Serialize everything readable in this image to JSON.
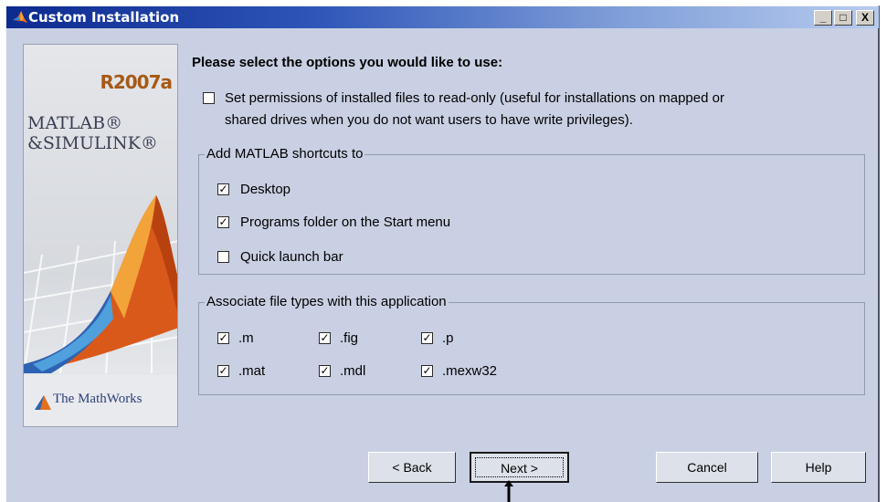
{
  "window": {
    "title": "Custom Installation",
    "controls": {
      "minimize": "_",
      "maximize": "□",
      "close": "X"
    }
  },
  "banner": {
    "release": "R2007a",
    "product": "MATLAB®\n&SIMULINK®",
    "company": "The MathWorks"
  },
  "heading": "Please select the options you would like to use:",
  "permissions": {
    "checked": false,
    "line1": "Set permissions of installed files to read-only (useful for installations on mapped or",
    "line2": "shared drives when you do not want users to have write privileges)."
  },
  "shortcuts": {
    "title": "Add MATLAB shortcuts to",
    "items": [
      {
        "label": "Desktop",
        "checked": true
      },
      {
        "label": "Programs folder on the Start menu",
        "checked": true
      },
      {
        "label": "Quick launch bar",
        "checked": false
      }
    ]
  },
  "associations": {
    "title": "Associate file types with this application",
    "items": [
      {
        "label": ".m",
        "checked": true
      },
      {
        "label": ".fig",
        "checked": true
      },
      {
        "label": ".p",
        "checked": true
      },
      {
        "label": ".mat",
        "checked": true
      },
      {
        "label": ".mdl",
        "checked": true
      },
      {
        "label": ".mexw32",
        "checked": true
      }
    ]
  },
  "buttons": {
    "back": "< Back",
    "next": "Next >",
    "cancel": "Cancel",
    "help": "Help"
  },
  "colors": {
    "dialog_bg": "#c9d0e3",
    "titlebar_start": "#0d2a8f",
    "titlebar_end": "#b7cbee"
  }
}
